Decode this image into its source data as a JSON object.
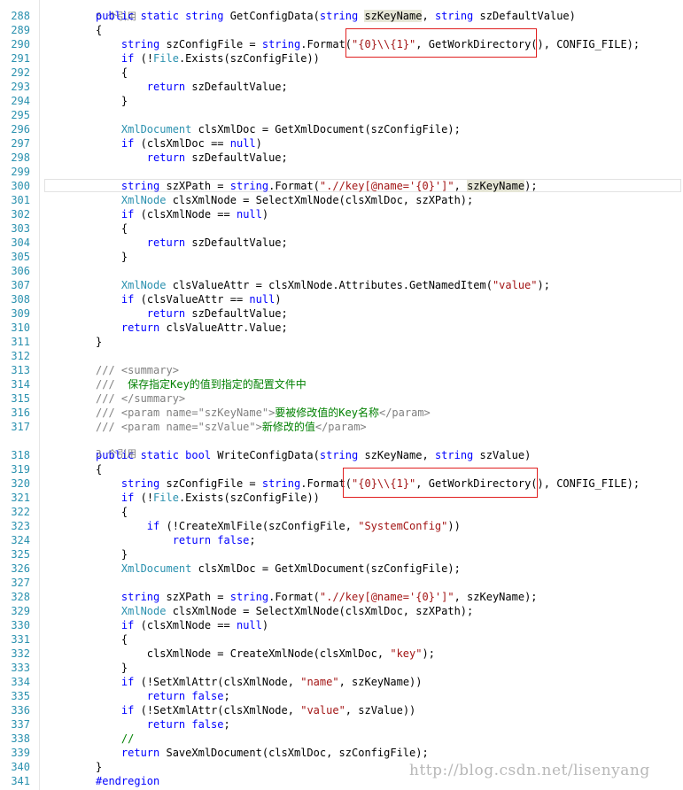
{
  "editor": {
    "references": {
      "top": "6 个引用",
      "write": "3 个引用"
    },
    "lines": [
      {
        "n": "288",
        "segs": [
          [
            "kw",
            "public static string "
          ],
          [
            "",
            "GetConfigData("
          ],
          [
            "kw",
            "string "
          ],
          [
            "hl",
            "szKeyName"
          ],
          [
            "",
            ", "
          ],
          [
            "kw",
            "string "
          ],
          [
            "",
            "szDefaultValue)"
          ]
        ]
      },
      {
        "n": "289",
        "segs": [
          [
            "",
            "{"
          ]
        ]
      },
      {
        "n": "290",
        "segs": [
          [
            "",
            "    "
          ],
          [
            "kw",
            "string "
          ],
          [
            "",
            "szConfigFile = "
          ],
          [
            "kw",
            "string"
          ],
          [
            "",
            ".Format("
          ],
          [
            "st",
            "\"{0}\\\\{1}\""
          ],
          [
            "",
            ", GetWorkDirectory(), CONFIG_FILE);"
          ]
        ]
      },
      {
        "n": "291",
        "segs": [
          [
            "",
            "    "
          ],
          [
            "kw",
            "if "
          ],
          [
            "",
            "(!"
          ],
          [
            "ty",
            "File"
          ],
          [
            "",
            ".Exists(szConfigFile))"
          ]
        ]
      },
      {
        "n": "292",
        "segs": [
          [
            "",
            "    {"
          ]
        ]
      },
      {
        "n": "293",
        "segs": [
          [
            "",
            "        "
          ],
          [
            "kw",
            "return "
          ],
          [
            "",
            "szDefaultValue;"
          ]
        ]
      },
      {
        "n": "294",
        "segs": [
          [
            "",
            "    }"
          ]
        ]
      },
      {
        "n": "295",
        "segs": []
      },
      {
        "n": "296",
        "segs": [
          [
            "",
            "    "
          ],
          [
            "ty",
            "XmlDocument "
          ],
          [
            "",
            "clsXmlDoc = GetXmlDocument(szConfigFile);"
          ]
        ]
      },
      {
        "n": "297",
        "segs": [
          [
            "",
            "    "
          ],
          [
            "kw",
            "if "
          ],
          [
            "",
            "(clsXmlDoc == "
          ],
          [
            "kw",
            "null"
          ],
          [
            "",
            ")"
          ]
        ]
      },
      {
        "n": "298",
        "segs": [
          [
            "",
            "        "
          ],
          [
            "kw",
            "return "
          ],
          [
            "",
            "szDefaultValue;"
          ]
        ]
      },
      {
        "n": "299",
        "segs": []
      },
      {
        "n": "300",
        "segs": [
          [
            "",
            "    "
          ],
          [
            "kw",
            "string "
          ],
          [
            "",
            "szXPath = "
          ],
          [
            "kw",
            "string"
          ],
          [
            "",
            ".Format("
          ],
          [
            "st",
            "\".//key[@name='{0}']\""
          ],
          [
            "",
            ", "
          ],
          [
            "hl",
            "szKeyName"
          ],
          [
            "",
            ");"
          ]
        ]
      },
      {
        "n": "301",
        "segs": [
          [
            "",
            "    "
          ],
          [
            "ty",
            "XmlNode "
          ],
          [
            "",
            "clsXmlNode = SelectXmlNode(clsXmlDoc, szXPath);"
          ]
        ]
      },
      {
        "n": "302",
        "segs": [
          [
            "",
            "    "
          ],
          [
            "kw",
            "if "
          ],
          [
            "",
            "(clsXmlNode == "
          ],
          [
            "kw",
            "null"
          ],
          [
            "",
            ")"
          ]
        ]
      },
      {
        "n": "303",
        "segs": [
          [
            "",
            "    {"
          ]
        ]
      },
      {
        "n": "304",
        "segs": [
          [
            "",
            "        "
          ],
          [
            "kw",
            "return "
          ],
          [
            "",
            "szDefaultValue;"
          ]
        ]
      },
      {
        "n": "305",
        "segs": [
          [
            "",
            "    }"
          ]
        ]
      },
      {
        "n": "306",
        "segs": []
      },
      {
        "n": "307",
        "segs": [
          [
            "",
            "    "
          ],
          [
            "ty",
            "XmlNode "
          ],
          [
            "",
            "clsValueAttr = clsXmlNode.Attributes.GetNamedItem("
          ],
          [
            "st",
            "\"value\""
          ],
          [
            "",
            ");"
          ]
        ]
      },
      {
        "n": "308",
        "segs": [
          [
            "",
            "    "
          ],
          [
            "kw",
            "if "
          ],
          [
            "",
            "(clsValueAttr == "
          ],
          [
            "kw",
            "null"
          ],
          [
            "",
            ")"
          ]
        ]
      },
      {
        "n": "309",
        "segs": [
          [
            "",
            "        "
          ],
          [
            "kw",
            "return "
          ],
          [
            "",
            "szDefaultValue;"
          ]
        ]
      },
      {
        "n": "310",
        "segs": [
          [
            "",
            "    "
          ],
          [
            "kw",
            "return "
          ],
          [
            "",
            "clsValueAttr.Value;"
          ]
        ]
      },
      {
        "n": "311",
        "segs": [
          [
            "",
            "}"
          ]
        ]
      },
      {
        "n": "312",
        "segs": []
      },
      {
        "n": "313",
        "segs": [
          [
            "cm",
            "/// <summary>"
          ]
        ]
      },
      {
        "n": "314",
        "segs": [
          [
            "cm",
            "/// "
          ],
          [
            "cg",
            " 保存指定Key的值到指定的配置文件中"
          ]
        ]
      },
      {
        "n": "315",
        "segs": [
          [
            "cm",
            "/// </summary>"
          ]
        ]
      },
      {
        "n": "316",
        "segs": [
          [
            "cm",
            "/// <param name=\"szKeyName\">"
          ],
          [
            "cg",
            "要被修改值的Key名称"
          ],
          [
            "cm",
            "</param>"
          ]
        ]
      },
      {
        "n": "317",
        "segs": [
          [
            "cm",
            "/// <param name=\"szValue\">"
          ],
          [
            "cg",
            "新修改的值"
          ],
          [
            "cm",
            "</param>"
          ]
        ]
      },
      {
        "n": "318",
        "segs": [
          [
            "kw",
            "public static bool "
          ],
          [
            "",
            "WriteConfigData("
          ],
          [
            "kw",
            "string "
          ],
          [
            "",
            "szKeyName, "
          ],
          [
            "kw",
            "string "
          ],
          [
            "",
            "szValue)"
          ]
        ]
      },
      {
        "n": "319",
        "segs": [
          [
            "",
            "{"
          ]
        ]
      },
      {
        "n": "320",
        "segs": [
          [
            "",
            "    "
          ],
          [
            "kw",
            "string "
          ],
          [
            "",
            "szConfigFile = "
          ],
          [
            "kw",
            "string"
          ],
          [
            "",
            ".Format("
          ],
          [
            "st",
            "\"{0}\\\\{1}\""
          ],
          [
            "",
            ", GetWorkDirectory(), CONFIG_FILE);"
          ]
        ]
      },
      {
        "n": "321",
        "segs": [
          [
            "",
            "    "
          ],
          [
            "kw",
            "if "
          ],
          [
            "",
            "(!"
          ],
          [
            "ty",
            "File"
          ],
          [
            "",
            ".Exists(szConfigFile))"
          ]
        ]
      },
      {
        "n": "322",
        "segs": [
          [
            "",
            "    {"
          ]
        ]
      },
      {
        "n": "323",
        "segs": [
          [
            "",
            "        "
          ],
          [
            "kw",
            "if "
          ],
          [
            "",
            "(!CreateXmlFile(szConfigFile, "
          ],
          [
            "st",
            "\"SystemConfig\""
          ],
          [
            "",
            "))"
          ]
        ]
      },
      {
        "n": "324",
        "segs": [
          [
            "",
            "            "
          ],
          [
            "kw",
            "return false"
          ],
          [
            "",
            ";"
          ]
        ]
      },
      {
        "n": "325",
        "segs": [
          [
            "",
            "    }"
          ]
        ]
      },
      {
        "n": "326",
        "segs": [
          [
            "",
            "    "
          ],
          [
            "ty",
            "XmlDocument "
          ],
          [
            "",
            "clsXmlDoc = GetXmlDocument(szConfigFile);"
          ]
        ]
      },
      {
        "n": "327",
        "segs": []
      },
      {
        "n": "328",
        "segs": [
          [
            "",
            "    "
          ],
          [
            "kw",
            "string "
          ],
          [
            "",
            "szXPath = "
          ],
          [
            "kw",
            "string"
          ],
          [
            "",
            ".Format("
          ],
          [
            "st",
            "\".//key[@name='{0}']\""
          ],
          [
            "",
            ", szKeyName);"
          ]
        ]
      },
      {
        "n": "329",
        "segs": [
          [
            "",
            "    "
          ],
          [
            "ty",
            "XmlNode "
          ],
          [
            "",
            "clsXmlNode = SelectXmlNode(clsXmlDoc, szXPath);"
          ]
        ]
      },
      {
        "n": "330",
        "segs": [
          [
            "",
            "    "
          ],
          [
            "kw",
            "if "
          ],
          [
            "",
            "(clsXmlNode == "
          ],
          [
            "kw",
            "null"
          ],
          [
            "",
            ")"
          ]
        ]
      },
      {
        "n": "331",
        "segs": [
          [
            "",
            "    {"
          ]
        ]
      },
      {
        "n": "332",
        "segs": [
          [
            "",
            "        clsXmlNode = CreateXmlNode(clsXmlDoc, "
          ],
          [
            "st",
            "\"key\""
          ],
          [
            "",
            ");"
          ]
        ]
      },
      {
        "n": "333",
        "segs": [
          [
            "",
            "    }"
          ]
        ]
      },
      {
        "n": "334",
        "segs": [
          [
            "",
            "    "
          ],
          [
            "kw",
            "if "
          ],
          [
            "",
            "(!SetXmlAttr(clsXmlNode, "
          ],
          [
            "st",
            "\"name\""
          ],
          [
            "",
            ", szKeyName))"
          ]
        ]
      },
      {
        "n": "335",
        "segs": [
          [
            "",
            "        "
          ],
          [
            "kw",
            "return false"
          ],
          [
            "",
            ";"
          ]
        ]
      },
      {
        "n": "336",
        "segs": [
          [
            "",
            "    "
          ],
          [
            "kw",
            "if "
          ],
          [
            "",
            "(!SetXmlAttr(clsXmlNode, "
          ],
          [
            "st",
            "\"value\""
          ],
          [
            "",
            ", szValue))"
          ]
        ]
      },
      {
        "n": "337",
        "segs": [
          [
            "",
            "        "
          ],
          [
            "kw",
            "return false"
          ],
          [
            "",
            ";"
          ]
        ]
      },
      {
        "n": "338",
        "segs": [
          [
            "",
            "    "
          ],
          [
            "cg",
            "//"
          ]
        ]
      },
      {
        "n": "339",
        "segs": [
          [
            "",
            "    "
          ],
          [
            "kw",
            "return "
          ],
          [
            "",
            "SaveXmlDocument(clsXmlDoc, szConfigFile);"
          ]
        ]
      },
      {
        "n": "340",
        "segs": [
          [
            "",
            "}"
          ]
        ]
      },
      {
        "n": "341",
        "segs": [
          [
            "pp",
            "#endregion"
          ]
        ]
      }
    ]
  },
  "watermark": "http://blog.csdn.net/lisenyang"
}
